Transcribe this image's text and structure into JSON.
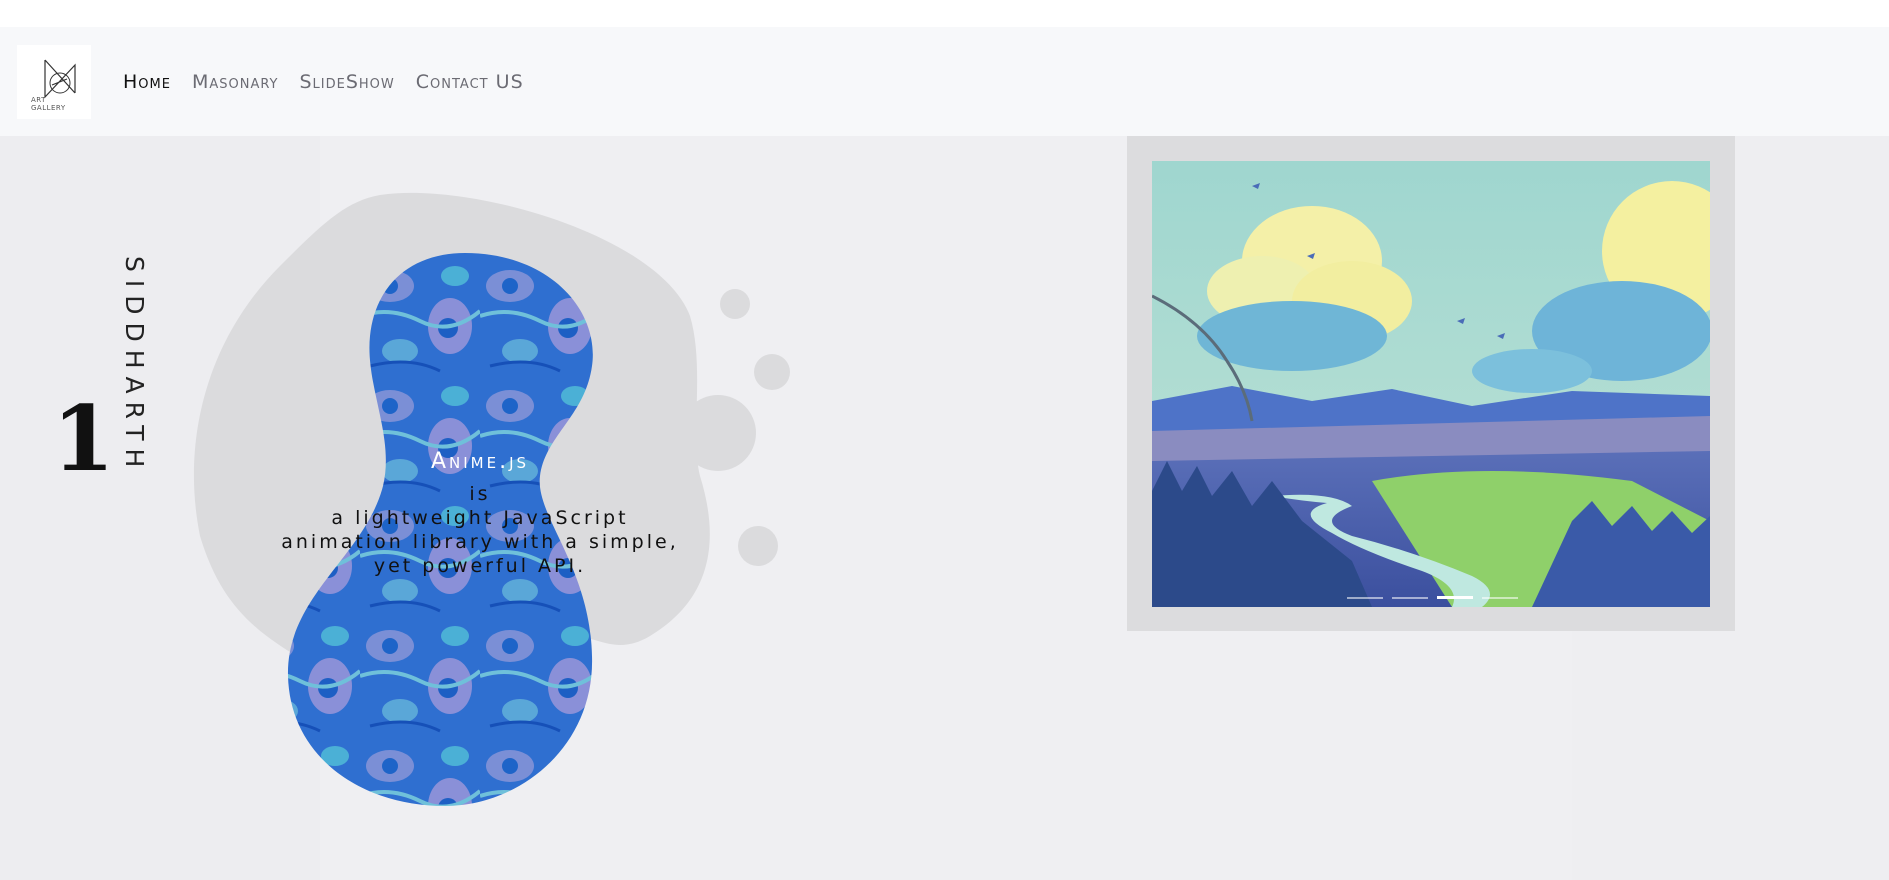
{
  "logo": {
    "text_line1": "ART",
    "text_line2": "GALLERY"
  },
  "nav": {
    "items": [
      {
        "label": "Home",
        "active": true
      },
      {
        "label": "Masonary",
        "active": false
      },
      {
        "label": "SlideShow",
        "active": false
      },
      {
        "label": "Contact US",
        "active": false
      }
    ]
  },
  "hero": {
    "number": "1",
    "vertical_name": "SIDDHARTH",
    "title": "Anime.js",
    "line1": "is",
    "line2": "a lightweight JavaScript",
    "line3": "animation library with a simple,",
    "line4": "yet powerful API."
  },
  "slideshow": {
    "image_name": "anime-landscape-image",
    "slide_count": 4,
    "active_slide": 3
  },
  "colors": {
    "navbar_bg": "#f7f8fa",
    "main_bg": "#efeff2",
    "blob_gray": "#dbdbdd",
    "blob_blue": "#2f6fd0",
    "frame_bg": "#dcdcde"
  }
}
